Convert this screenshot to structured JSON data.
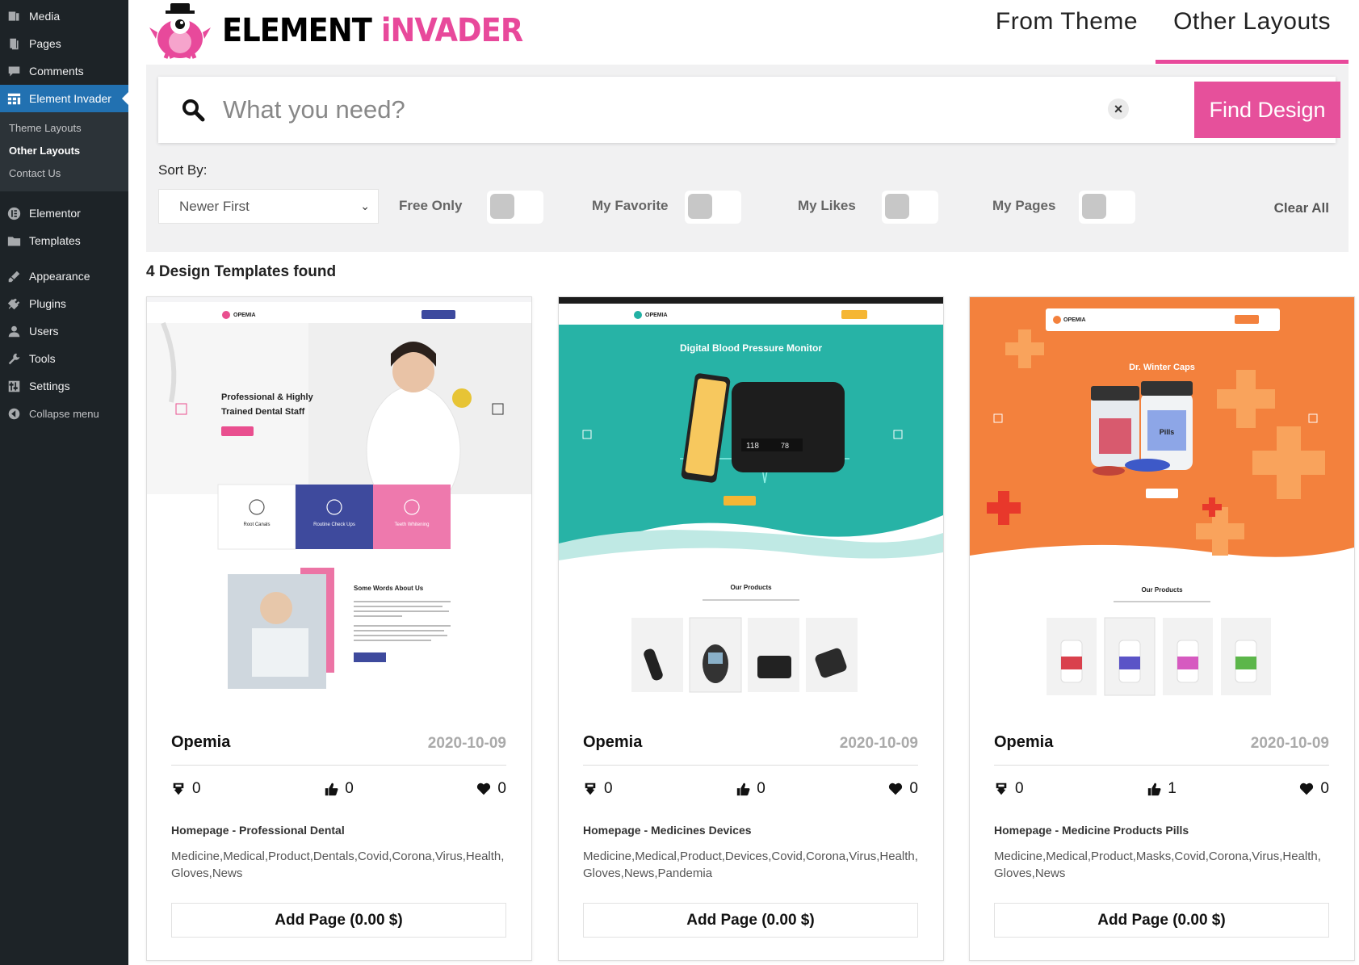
{
  "sidebar": {
    "items": [
      {
        "label": "Media",
        "icon": "media-icon"
      },
      {
        "label": "Pages",
        "icon": "pages-icon"
      },
      {
        "label": "Comments",
        "icon": "comments-icon"
      },
      {
        "label": "Element Invader",
        "icon": "grid-icon"
      }
    ],
    "sub": [
      "Theme Layouts",
      "Other Layouts",
      "Contact Us"
    ],
    "items2": [
      {
        "label": "Elementor",
        "icon": "elementor-icon"
      },
      {
        "label": "Templates",
        "icon": "folder-icon"
      }
    ],
    "items3": [
      {
        "label": "Appearance",
        "icon": "brush-icon"
      },
      {
        "label": "Plugins",
        "icon": "plug-icon"
      },
      {
        "label": "Users",
        "icon": "user-icon"
      },
      {
        "label": "Tools",
        "icon": "wrench-icon"
      },
      {
        "label": "Settings",
        "icon": "settings-icon"
      },
      {
        "label": "Collapse menu",
        "icon": "collapse-icon"
      }
    ]
  },
  "logo": {
    "part1": "ELEMENT",
    "part2": "iNVADER"
  },
  "nav": {
    "from_theme": "From Theme",
    "other_layouts": "Other Layouts"
  },
  "search": {
    "placeholder": "What you need?",
    "clear": "×",
    "button": "Find Design"
  },
  "filters": {
    "sort_label": "Sort By:",
    "sort_value": "Newer First",
    "free_only": "Free Only",
    "my_favorite": "My Favorite",
    "my_likes": "My Likes",
    "my_pages": "My Pages",
    "clear_all": "Clear All"
  },
  "found": "4 Design Templates found",
  "colors": {
    "accent": "#e6509b",
    "wp_sidebar": "#1d2327",
    "wp_active": "#2271b1"
  },
  "cards": [
    {
      "title": "Opemia",
      "date": "2020-10-09",
      "downloads": "0",
      "likes": "0",
      "favorites": "0",
      "name": "Homepage - Professional Dental",
      "tags": "Medicine,Medical,Product,Dentals,Covid,Corona,Virus,Health,Gloves,News",
      "button": "Add Page (0.00 $)",
      "thumb": {
        "brand": "OPEMIA",
        "headline": "Professional & Highly Trained Dental Staff",
        "box1": "Root Canals",
        "box2": "Routine Check Ups",
        "box3": "Teeth Whitening",
        "about": "Some Words About Us"
      }
    },
    {
      "title": "Opemia",
      "date": "2020-10-09",
      "downloads": "0",
      "likes": "0",
      "favorites": "0",
      "name": "Homepage - Medicines Devices",
      "tags": "Medicine,Medical,Product,Devices,Covid,Corona,Virus,Health,Gloves,News,Pandemia",
      "button": "Add Page (0.00 $)",
      "thumb": {
        "brand": "OPEMIA",
        "headline": "Digital Blood Pressure Monitor",
        "products": "Our Products",
        "reading": "118",
        "pulse": "78"
      }
    },
    {
      "title": "Opemia",
      "date": "2020-10-09",
      "downloads": "0",
      "likes": "1",
      "favorites": "0",
      "name": "Homepage - Medicine Products Pills",
      "tags": "Medicine,Medical,Product,Masks,Covid,Corona,Virus,Health,Gloves,News",
      "button": "Add Page (0.00 $)",
      "thumb": {
        "brand": "OPEMIA",
        "headline": "Dr. Winter Caps",
        "products": "Our Products",
        "bottle": "Pills Bottle Winter"
      }
    }
  ]
}
